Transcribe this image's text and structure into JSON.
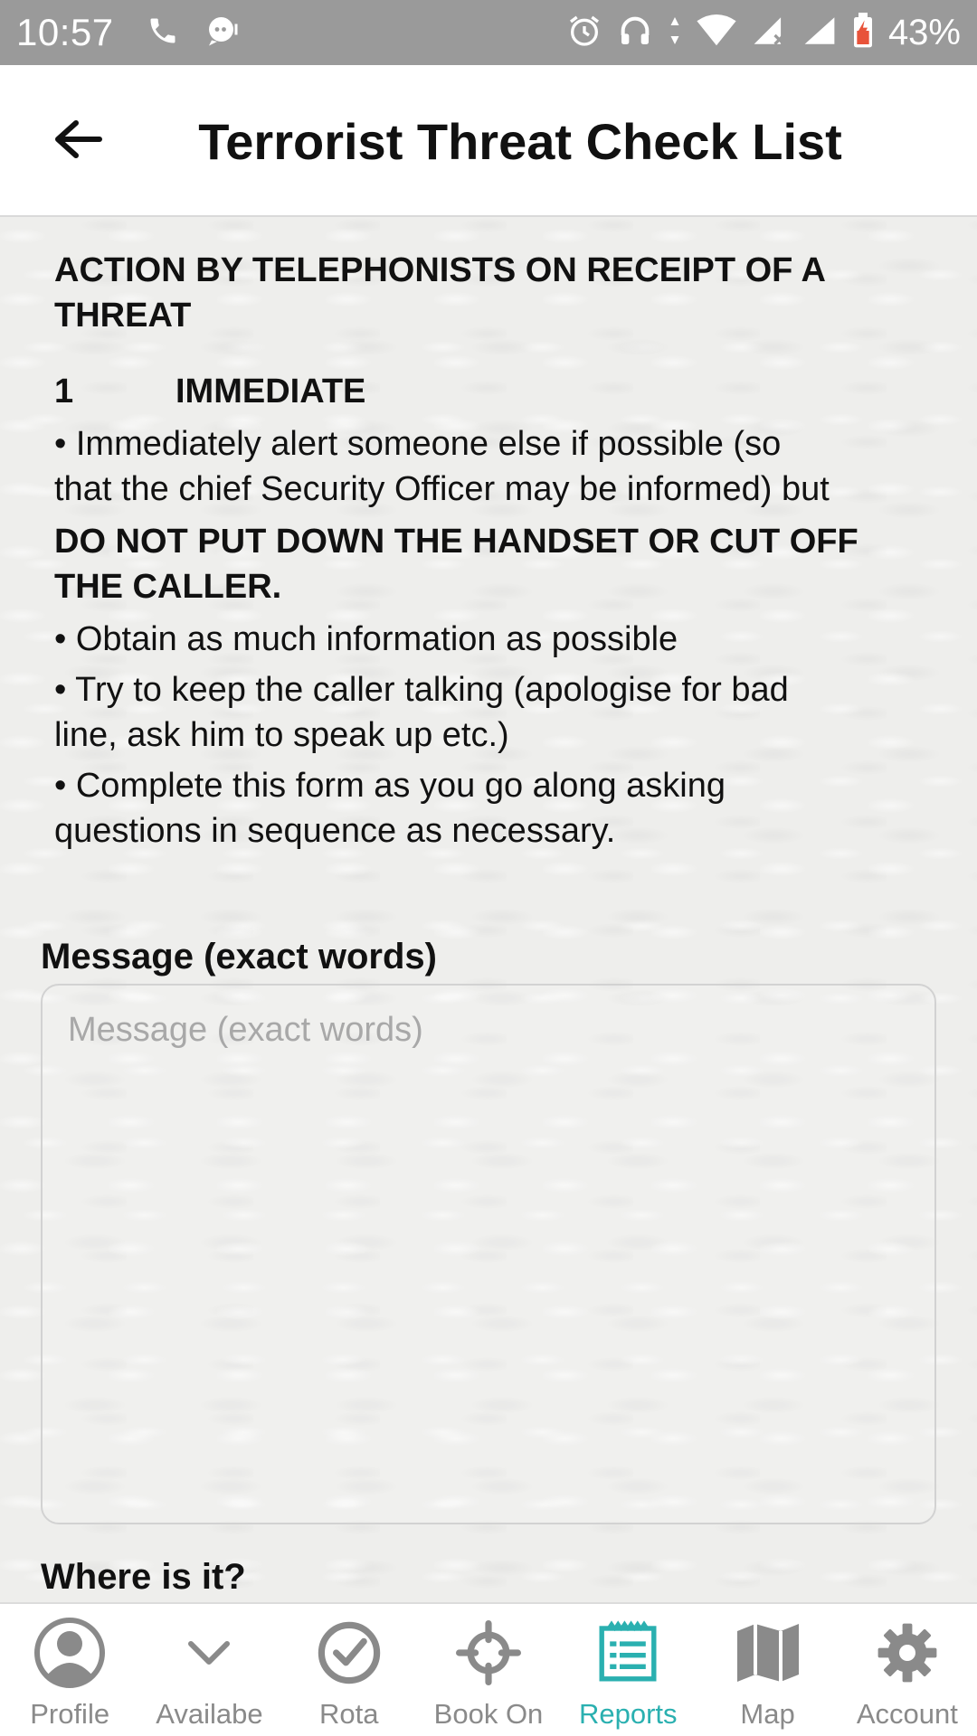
{
  "status_bar": {
    "time": "10:57",
    "battery": "43%"
  },
  "app_bar": {
    "title": "Terrorist Threat Check List"
  },
  "content": {
    "heading_line1": "ACTION BY TELEPHONISTS ON RECEIPT OF A",
    "heading_line2": "THREAT",
    "section_number": "1",
    "section_title": "IMMEDIATE",
    "bullet1_line1": "• Immediately alert someone else if possible (so",
    "bullet1_line2": "that the chief Security Officer may be informed) but",
    "warning_line1": "DO NOT PUT DOWN THE HANDSET OR CUT OFF",
    "warning_line2": "THE CALLER.",
    "bullet2": "• Obtain as much information as possible",
    "bullet3_line1": "• Try to keep the caller talking (apologise for bad",
    "bullet3_line2": "line, ask him to speak up etc.)",
    "bullet4_line1": "• Complete this form as you go along asking",
    "bullet4_line2": "questions in sequence as necessary."
  },
  "form": {
    "message_label": "Message (exact words)",
    "message_placeholder": "Message (exact words)",
    "message_value": "",
    "where_label": "Where is it?"
  },
  "bottom_nav": {
    "items": [
      {
        "label": "Profile",
        "icon": "profile-icon",
        "active": false
      },
      {
        "label": "Availabe",
        "icon": "chevron-down-icon",
        "active": false
      },
      {
        "label": "Rota",
        "icon": "check-circle-icon",
        "active": false
      },
      {
        "label": "Book On",
        "icon": "crosshair-icon",
        "active": false
      },
      {
        "label": "Reports",
        "icon": "report-icon",
        "active": true
      },
      {
        "label": "Map",
        "icon": "map-icon",
        "active": false
      },
      {
        "label": "Account",
        "icon": "gear-icon",
        "active": false
      }
    ]
  },
  "colors": {
    "accent": "#2ab0b0",
    "status_bar": "#9a9a9a",
    "nav_inactive": "#8a8a8a"
  }
}
